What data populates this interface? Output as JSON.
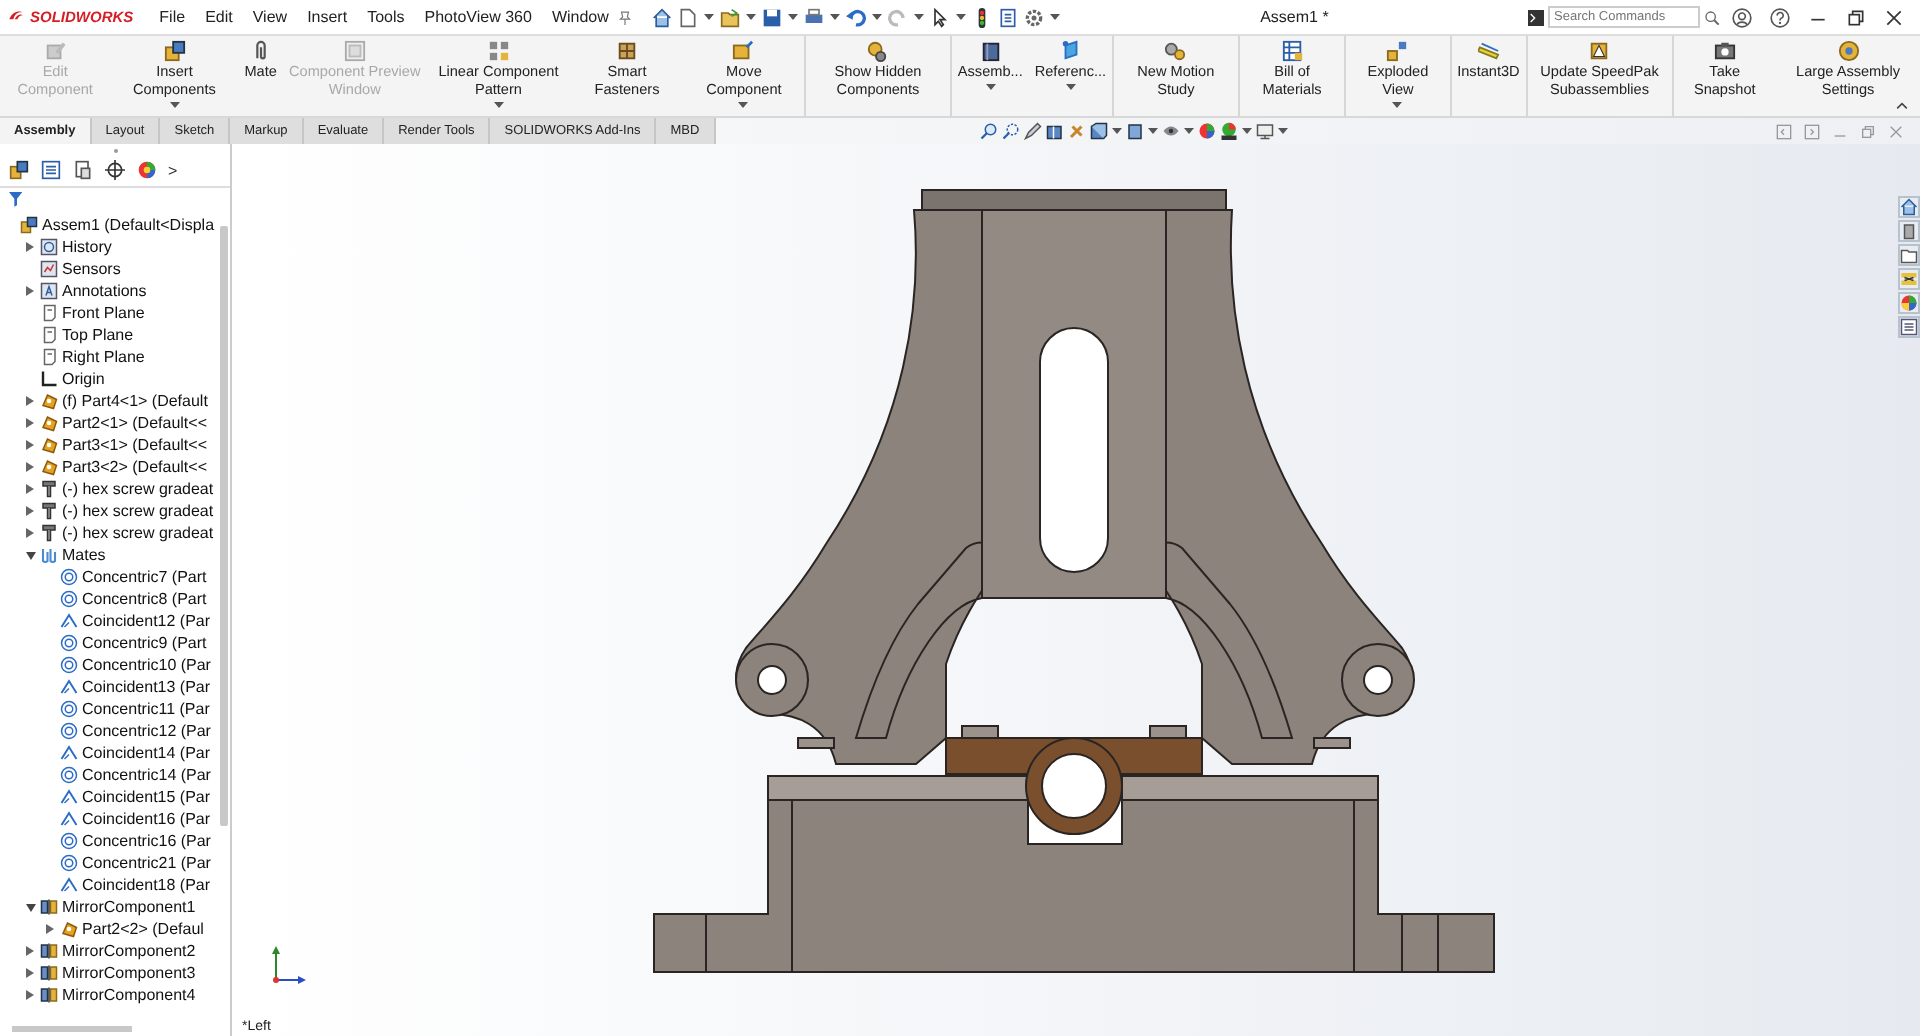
{
  "app": {
    "logo": "SOLIDWORKS",
    "menu": [
      "File",
      "Edit",
      "View",
      "Insert",
      "Tools",
      "PhotoView 360",
      "Window"
    ],
    "title": "Assem1 *",
    "search": {
      "placeholder": "Search Commands"
    }
  },
  "ribbon": [
    {
      "label": "Edit Component",
      "disabled": true,
      "dropdown": false,
      "separator_before": false
    },
    {
      "label": "Insert Components",
      "disabled": false,
      "dropdown": true,
      "separator_before": false
    },
    {
      "label": "Mate",
      "disabled": false,
      "dropdown": false,
      "separator_before": false
    },
    {
      "label": "Component Preview Window",
      "disabled": true,
      "dropdown": false,
      "separator_before": false
    },
    {
      "label": "Linear Component Pattern",
      "disabled": false,
      "dropdown": true,
      "separator_before": false
    },
    {
      "label": "Smart Fasteners",
      "disabled": false,
      "dropdown": false,
      "separator_before": false
    },
    {
      "label": "Move Component",
      "disabled": false,
      "dropdown": true,
      "separator_before": false
    },
    {
      "label": "Show Hidden Components",
      "disabled": false,
      "dropdown": false,
      "separator_before": true
    },
    {
      "label": "Assemb...",
      "disabled": false,
      "dropdown": true,
      "separator_before": true
    },
    {
      "label": "Referenc...",
      "disabled": false,
      "dropdown": true,
      "separator_before": false
    },
    {
      "label": "New Motion Study",
      "disabled": false,
      "dropdown": false,
      "separator_before": true
    },
    {
      "label": "Bill of Materials",
      "disabled": false,
      "dropdown": false,
      "separator_before": true
    },
    {
      "label": "Exploded View",
      "disabled": false,
      "dropdown": true,
      "separator_before": true
    },
    {
      "label": "Instant3D",
      "disabled": false,
      "dropdown": false,
      "separator_before": true
    },
    {
      "label": "Update SpeedPak Subassemblies",
      "disabled": false,
      "dropdown": false,
      "separator_before": true
    },
    {
      "label": "Take Snapshot",
      "disabled": false,
      "dropdown": false,
      "separator_before": true
    },
    {
      "label": "Large Assembly Settings",
      "disabled": false,
      "dropdown": false,
      "separator_before": false
    }
  ],
  "tabs": [
    {
      "label": "Assembly",
      "selected": true
    },
    {
      "label": "Layout",
      "selected": false
    },
    {
      "label": "Sketch",
      "selected": false
    },
    {
      "label": "Markup",
      "selected": false
    },
    {
      "label": "Evaluate",
      "selected": false
    },
    {
      "label": "Render Tools",
      "selected": false
    },
    {
      "label": "SOLIDWORKS Add-Ins",
      "selected": false
    },
    {
      "label": "MBD",
      "selected": false
    }
  ],
  "panel": {
    "more_tabs": ">"
  },
  "tree": [
    {
      "label": "Assem1  (Default<Displa",
      "kind": "assembly",
      "children": [
        {
          "label": "History",
          "kind": "history",
          "expanded": false
        },
        {
          "label": "Sensors",
          "kind": "sensor"
        },
        {
          "label": "Annotations",
          "kind": "annotation",
          "expanded": false
        },
        {
          "label": "Front Plane",
          "kind": "plane"
        },
        {
          "label": "Top Plane",
          "kind": "plane"
        },
        {
          "label": "Right Plane",
          "kind": "plane"
        },
        {
          "label": "Origin",
          "kind": "origin"
        },
        {
          "label": "(f) Part4<1> (Default",
          "kind": "part",
          "expanded": false
        },
        {
          "label": "Part2<1> (Default<<",
          "kind": "part",
          "expanded": false
        },
        {
          "label": "Part3<1> (Default<<",
          "kind": "part",
          "expanded": false
        },
        {
          "label": "Part3<2> (Default<<",
          "kind": "part",
          "expanded": false
        },
        {
          "label": "(-) hex screw gradeat",
          "kind": "screw",
          "expanded": false
        },
        {
          "label": "(-) hex screw gradeat",
          "kind": "screw",
          "expanded": false
        },
        {
          "label": "(-) hex screw gradeat",
          "kind": "screw",
          "expanded": false
        },
        {
          "label": "Mates",
          "kind": "mates",
          "expanded": true,
          "children": [
            {
              "label": "Concentric7 (Part",
              "kind": "concentric"
            },
            {
              "label": "Concentric8 (Part",
              "kind": "concentric"
            },
            {
              "label": "Coincident12 (Par",
              "kind": "coincident"
            },
            {
              "label": "Concentric9 (Part",
              "kind": "concentric"
            },
            {
              "label": "Concentric10 (Par",
              "kind": "concentric"
            },
            {
              "label": "Coincident13 (Par",
              "kind": "coincident"
            },
            {
              "label": "Concentric11 (Par",
              "kind": "concentric"
            },
            {
              "label": "Concentric12 (Par",
              "kind": "concentric"
            },
            {
              "label": "Coincident14 (Par",
              "kind": "coincident"
            },
            {
              "label": "Concentric14 (Par",
              "kind": "concentric"
            },
            {
              "label": "Coincident15 (Par",
              "kind": "coincident"
            },
            {
              "label": "Coincident16 (Par",
              "kind": "coincident"
            },
            {
              "label": "Concentric16 (Par",
              "kind": "concentric"
            },
            {
              "label": "Concentric21 (Par",
              "kind": "concentric"
            },
            {
              "label": "Coincident18 (Par",
              "kind": "coincident"
            }
          ]
        },
        {
          "label": "MirrorComponent1",
          "kind": "mirror",
          "expanded": true,
          "children": [
            {
              "label": "Part2<2> (Defaul",
              "kind": "part",
              "expanded": false
            }
          ]
        },
        {
          "label": "MirrorComponent2",
          "kind": "mirror",
          "expanded": false
        },
        {
          "label": "MirrorComponent3",
          "kind": "mirror",
          "expanded": false
        },
        {
          "label": "MirrorComponent4",
          "kind": "mirror",
          "expanded": false
        }
      ]
    }
  ],
  "viewport": {
    "view_name": "*Left"
  }
}
